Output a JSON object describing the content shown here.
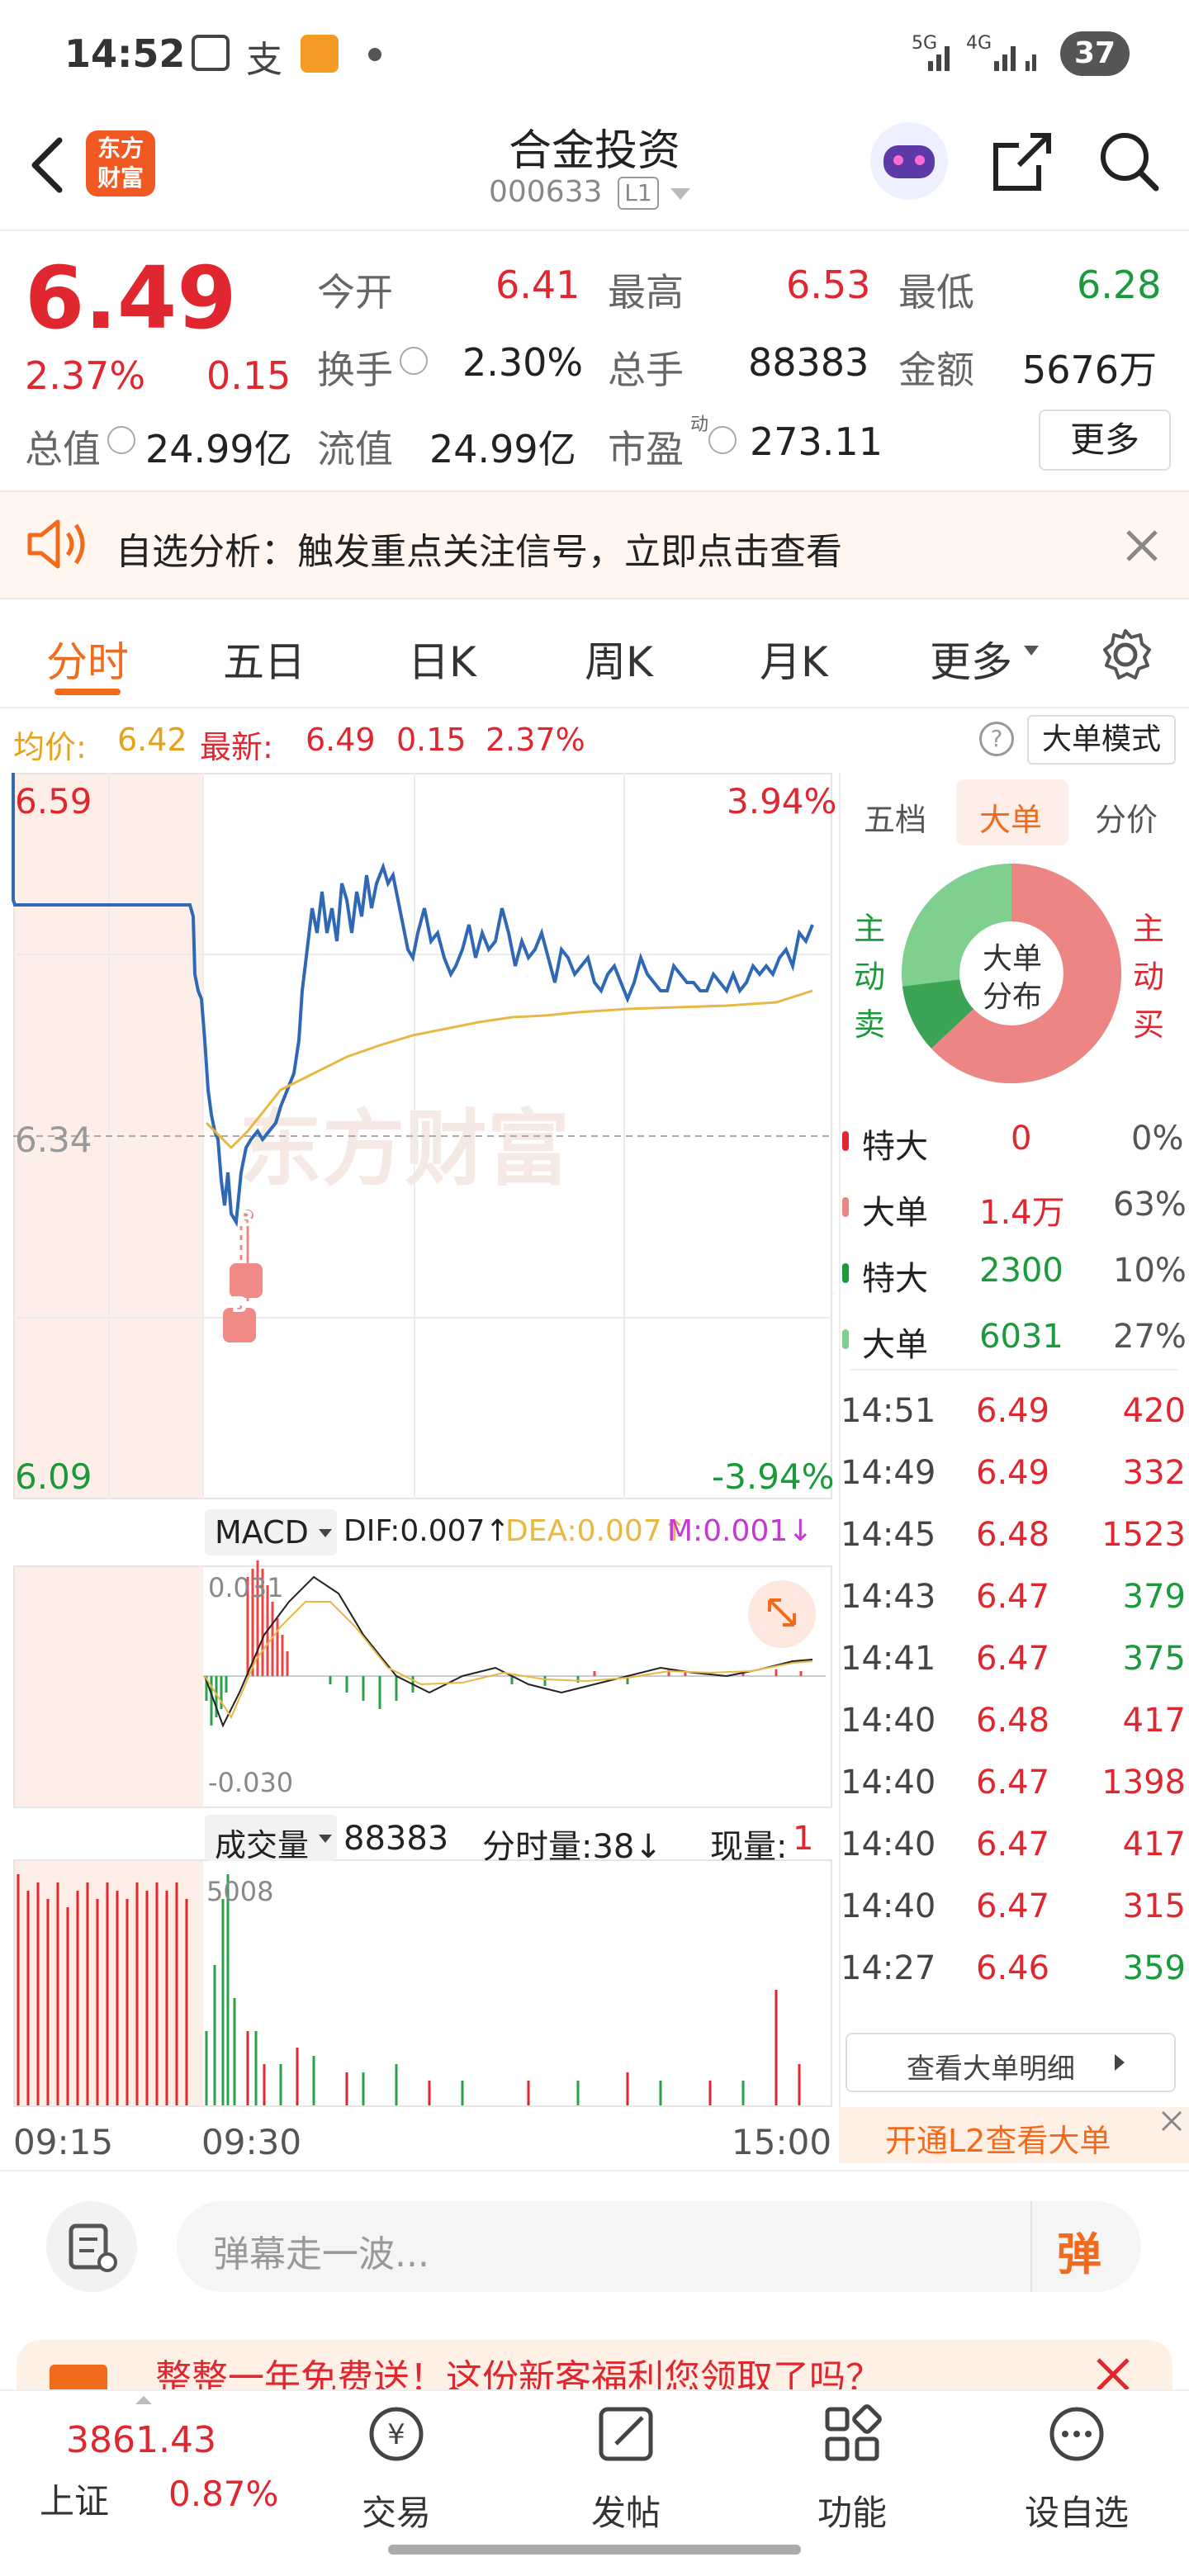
{
  "status": {
    "time": "14:52",
    "battery": "37",
    "signal1": "5G",
    "signal2": "4G"
  },
  "header": {
    "logo_line1": "东方",
    "logo_line2": "财富",
    "title": "合金投资",
    "code": "000633",
    "level": "L1"
  },
  "quote": {
    "price": "6.49",
    "pct": "2.37%",
    "change": "0.15",
    "open_label": "今开",
    "open": "6.41",
    "high_label": "最高",
    "high": "6.53",
    "low_label": "最低",
    "low": "6.28",
    "turnover_label": "换手",
    "turnover": "2.30%",
    "volume_label": "总手",
    "volume": "88383",
    "amount_label": "金额",
    "amount": "5676万",
    "mktcap_label": "总值",
    "mktcap": "24.99亿",
    "float_label": "流值",
    "float": "24.99亿",
    "pe_label": "市盈",
    "pe_sup": "动",
    "pe": "273.11",
    "more_label": "更多"
  },
  "banner": {
    "text": "自选分析：触发重点关注信号，立即点击查看"
  },
  "tabs": [
    {
      "label": "分时"
    },
    {
      "label": "五日"
    },
    {
      "label": "日K"
    },
    {
      "label": "周K"
    },
    {
      "label": "月K"
    },
    {
      "label": "更多"
    }
  ],
  "info_line": {
    "avg_label": "均价:",
    "avg": "6.42",
    "latest_label": "最新:",
    "latest": "6.49",
    "chg": "0.15",
    "pct": "2.37%",
    "mode_button": "大单模式"
  },
  "chart": {
    "y_top": "6.59",
    "y_mid": "6.34",
    "y_bottom": "6.09",
    "pct_top": "3.94%",
    "pct_bottom": "-3.94%",
    "watermark": "东方财富",
    "marker": "B",
    "macd_label": "MACD",
    "dif": "DIF:0.007↑",
    "dea": "DEA:0.007↑",
    "m": "M:0.001↓",
    "macd_top": "0.031",
    "macd_bottom": "-0.030",
    "vol_label": "成交量",
    "vol_total": "88383",
    "vol_period": "分时量:38↓",
    "vol_now_label": "现量:",
    "vol_now": "1",
    "vol_max": "5008",
    "x_start": "09:15",
    "x_mid": "09:30",
    "x_end": "15:00"
  },
  "chart_data": {
    "type": "line",
    "x": [
      "09:15",
      "09:30",
      "15:00"
    ],
    "series": [],
    "ylim": [
      6.09,
      6.59
    ],
    "grid": true
  },
  "side": {
    "tabs": [
      {
        "label": "五档"
      },
      {
        "label": "大单"
      },
      {
        "label": "分价"
      }
    ],
    "donut_center1": "大单",
    "donut_center2": "分布",
    "sell_label": [
      "主",
      "动",
      "卖"
    ],
    "buy_label": [
      "主",
      "动",
      "买"
    ],
    "donut": [
      {
        "name": "buy",
        "value": 63,
        "color": "#ee8585"
      },
      {
        "name": "sell_big",
        "value": 10,
        "color": "#3aa454"
      },
      {
        "name": "sell",
        "value": 27,
        "color": "#7fcf8e"
      }
    ],
    "stats": [
      {
        "label": "特大",
        "value": "0",
        "pct": "0%",
        "color": "#e0262e"
      },
      {
        "label": "大单",
        "value": "1.4万",
        "pct": "63%",
        "color": "#ee8585"
      },
      {
        "label": "特大",
        "value": "2300",
        "pct": "10%",
        "color": "#1a9a3a"
      },
      {
        "label": "大单",
        "value": "6031",
        "pct": "27%",
        "color": "#7fcf8e"
      }
    ],
    "trades": [
      {
        "time": "14:51",
        "price": "6.49",
        "vol": "420"
      },
      {
        "time": "14:49",
        "price": "6.49",
        "vol": "332"
      },
      {
        "time": "14:45",
        "price": "6.48",
        "vol": "1523"
      },
      {
        "time": "14:43",
        "price": "6.47",
        "vol": "379"
      },
      {
        "time": "14:41",
        "price": "6.47",
        "vol": "375"
      },
      {
        "time": "14:40",
        "price": "6.48",
        "vol": "417"
      },
      {
        "time": "14:40",
        "price": "6.47",
        "vol": "1398"
      },
      {
        "time": "14:40",
        "price": "6.47",
        "vol": "417"
      },
      {
        "time": "14:40",
        "price": "6.47",
        "vol": "315"
      },
      {
        "time": "14:27",
        "price": "6.46",
        "vol": "359"
      }
    ],
    "detail_button": "查看大单明细",
    "l2_button": "开通L2查看大单"
  },
  "comment": {
    "placeholder": "弹幕走一波...",
    "danmu": "弹"
  },
  "promo": {
    "text": "整整一年免费送！这份新客福利您领取了吗？"
  },
  "bottom": {
    "index_value": "3861.43",
    "index_name": "上证",
    "index_pct": "0.87%",
    "items": [
      {
        "label": "交易"
      },
      {
        "label": "发帖"
      },
      {
        "label": "功能"
      },
      {
        "label": "设自选"
      }
    ]
  }
}
